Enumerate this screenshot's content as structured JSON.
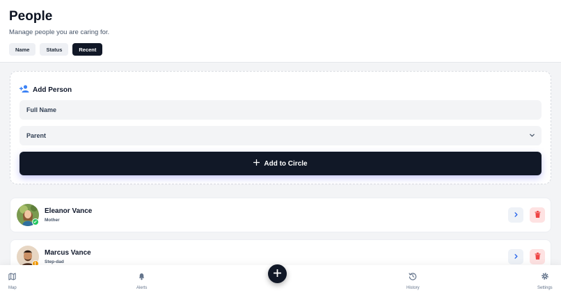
{
  "header": {
    "title": "People",
    "subtitle": "Manage people you are caring for.",
    "filters": [
      {
        "label": "Name",
        "active": false
      },
      {
        "label": "Status",
        "active": false
      },
      {
        "label": "Recent",
        "active": true
      }
    ]
  },
  "add_person": {
    "title": "Add Person",
    "name_placeholder": "Full Name",
    "relation_value": "Parent",
    "submit_label": "Add to Circle"
  },
  "people": [
    {
      "name": "Eleanor Vance",
      "relation": "Mother",
      "status_color": "#22c55e"
    },
    {
      "name": "Marcus Vance",
      "relation": "Step-dad",
      "status_color": "#f59e0b"
    }
  ],
  "nav": {
    "map": "Map",
    "alerts": "Alerts",
    "history": "History",
    "settings": "Settings"
  },
  "colors": {
    "primary": "#111827",
    "accent": "#3b82f6",
    "danger": "#ef4444"
  }
}
